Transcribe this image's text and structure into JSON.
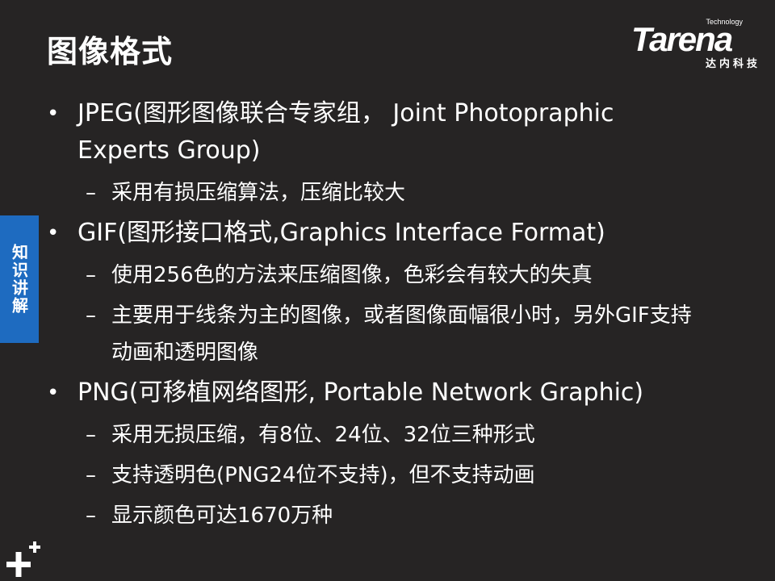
{
  "slide": {
    "title": "图像格式",
    "side_tab": "知识讲解"
  },
  "logo": {
    "word": "Tarena",
    "tagline": "Technology",
    "chinese": "达内科技"
  },
  "bullets": [
    {
      "marker": "•",
      "text": "JPEG(图形图像联合专家组， Joint Photopraphic Experts Group)",
      "subs": [
        {
          "marker": "–",
          "text": "采用有损压缩算法，压缩比较大"
        }
      ]
    },
    {
      "marker": "•",
      "text": "GIF(图形接口格式,Graphics Interface Format)",
      "subs": [
        {
          "marker": "–",
          "text": "使用256色的方法来压缩图像，色彩会有较大的失真"
        },
        {
          "marker": "–",
          "text": "主要用于线条为主的图像，或者图像面幅很小时，另外GIF支持动画和透明图像"
        }
      ]
    },
    {
      "marker": "•",
      "text": "PNG(可移植网络图形, Portable Network Graphic)",
      "subs": [
        {
          "marker": "–",
          "text": "采用无损压缩，有8位、24位、32位三种形式"
        },
        {
          "marker": "–",
          "text": "支持透明色(PNG24位不支持)，但不支持动画"
        },
        {
          "marker": "–",
          "text": "显示颜色可达1670万种"
        }
      ]
    }
  ],
  "icons": {
    "corner": "plus-mark-icon"
  },
  "colors": {
    "background": "#262424",
    "text": "#ffffff",
    "side_tab": "#1e6bc0"
  }
}
